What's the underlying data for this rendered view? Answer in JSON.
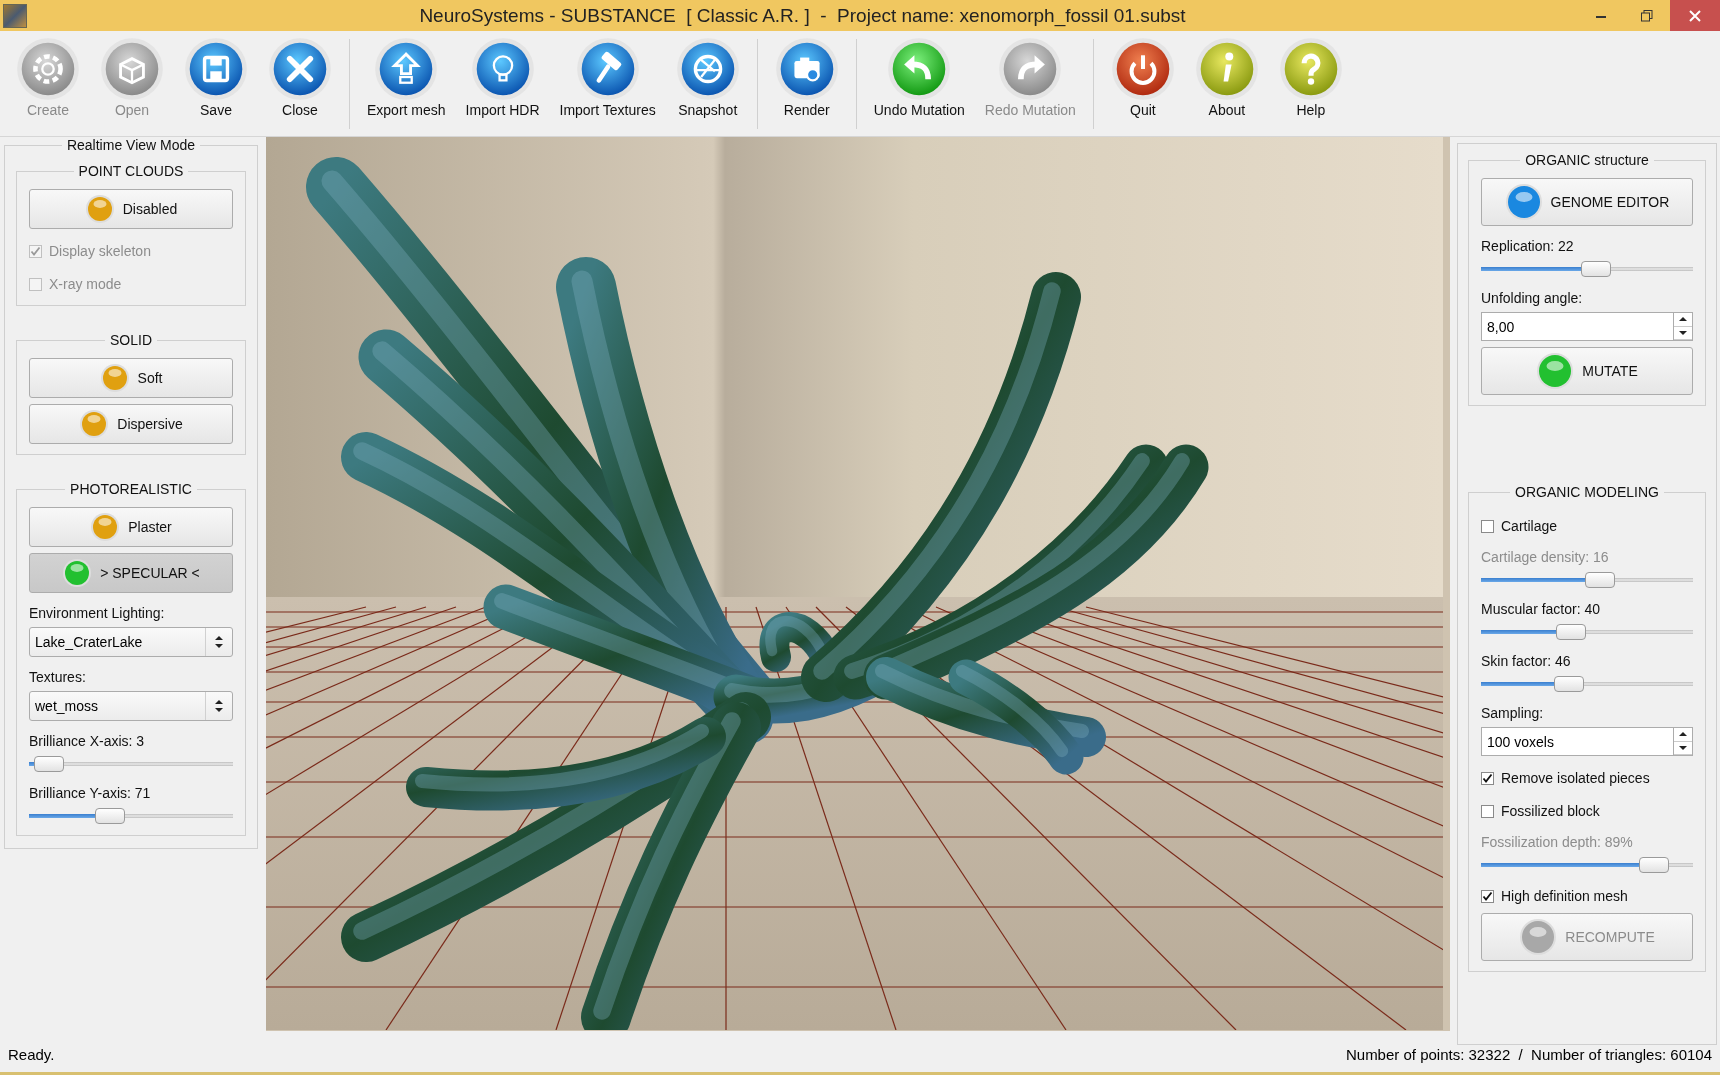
{
  "window": {
    "title": "NeuroSystems - SUBSTANCE  [ Classic A.R. ]  -  Project name: xenomorph_fossil 01.subst"
  },
  "toolbar": {
    "groups": [
      [
        {
          "label": "Create",
          "kind": "gear",
          "disabled": true
        },
        {
          "label": "Open",
          "kind": "box",
          "disabled": true
        },
        {
          "label": "Save",
          "kind": "disk",
          "disabled": false
        },
        {
          "label": "Close",
          "kind": "cross",
          "disabled": false
        }
      ],
      [
        {
          "label": "Export mesh",
          "kind": "upload",
          "disabled": false
        },
        {
          "label": "Import HDR",
          "kind": "bulb",
          "disabled": false
        },
        {
          "label": "Import Textures",
          "kind": "roller",
          "disabled": false
        },
        {
          "label": "Snapshot",
          "kind": "aperture",
          "disabled": false
        }
      ],
      [
        {
          "label": "Render",
          "kind": "camera",
          "disabled": false
        }
      ],
      [
        {
          "label": "Undo Mutation",
          "kind": "undo",
          "disabled": false
        },
        {
          "label": "Redo Mutation",
          "kind": "redo",
          "disabled": true
        }
      ],
      [
        {
          "label": "Quit",
          "kind": "power",
          "disabled": false
        },
        {
          "label": "About",
          "kind": "info",
          "disabled": false
        },
        {
          "label": "Help",
          "kind": "help",
          "disabled": false
        }
      ]
    ]
  },
  "left_panel": {
    "title": "Realtime View Mode",
    "sections": [
      {
        "title": "POINT CLOUDS",
        "items": [
          {
            "kind": "led_button",
            "label": "Disabled",
            "color": "#e0a010",
            "selected": false,
            "disabled": false
          },
          {
            "kind": "checkbox",
            "label": "Display skeleton",
            "checked": true,
            "disabled": true
          },
          {
            "kind": "checkbox",
            "label": "X-ray mode",
            "checked": false,
            "disabled": true
          }
        ]
      },
      {
        "title": "SOLID",
        "items": [
          {
            "kind": "led_button",
            "label": "Soft",
            "color": "#e0a010",
            "selected": false,
            "disabled": false
          },
          {
            "kind": "led_button",
            "label": "Dispersive",
            "color": "#e0a010",
            "selected": false,
            "disabled": false
          }
        ]
      },
      {
        "title": "PHOTOREALISTIC",
        "items": [
          {
            "kind": "led_button",
            "label": "Plaster",
            "color": "#e0a010",
            "selected": false,
            "disabled": false
          },
          {
            "kind": "led_button",
            "label": "> SPECULAR <",
            "color": "#22c030",
            "selected": true,
            "disabled": false
          },
          {
            "kind": "label",
            "label": "Environment Lighting:",
            "disabled": false
          },
          {
            "kind": "combo",
            "value": "Lake_CraterLake"
          },
          {
            "kind": "label",
            "label": "Textures:",
            "disabled": false
          },
          {
            "kind": "combo",
            "value": "wet_moss"
          },
          {
            "kind": "label",
            "label": "Brilliance X-axis: 3",
            "disabled": false
          },
          {
            "kind": "slider",
            "level": 0.03
          },
          {
            "kind": "label",
            "label": "Brilliance Y-axis: 71",
            "disabled": false
          },
          {
            "kind": "slider",
            "level": 0.38
          }
        ]
      }
    ]
  },
  "right_panel": {
    "sections": [
      {
        "title": "ORGANIC structure",
        "items": [
          {
            "kind": "led_button",
            "label": "GENOME EDITOR",
            "color": "#1a88e0",
            "selected": false,
            "disabled": false
          },
          {
            "kind": "label",
            "label": "Replication: 22",
            "disabled": false
          },
          {
            "kind": "slider",
            "level": 0.55
          },
          {
            "kind": "label",
            "label": "Unfolding angle:",
            "disabled": false
          },
          {
            "kind": "spin",
            "value": "8,00"
          },
          {
            "kind": "led_button",
            "label": "MUTATE",
            "color": "#22c030",
            "selected": false,
            "disabled": false
          }
        ]
      },
      {
        "title": "ORGANIC MODELING",
        "items": [
          {
            "kind": "checkbox",
            "label": "Cartilage",
            "checked": false,
            "disabled": false
          },
          {
            "kind": "label",
            "label": "Cartilage density: 16",
            "disabled": true
          },
          {
            "kind": "slider",
            "level": 0.57
          },
          {
            "kind": "label",
            "label": "Muscular factor: 40",
            "disabled": false
          },
          {
            "kind": "slider",
            "level": 0.41
          },
          {
            "kind": "label",
            "label": "Skin factor: 46",
            "disabled": false
          },
          {
            "kind": "slider",
            "level": 0.4
          },
          {
            "kind": "label",
            "label": "Sampling:",
            "disabled": false
          },
          {
            "kind": "spin",
            "value": "100 voxels"
          },
          {
            "kind": "checkbox",
            "label": "Remove isolated pieces",
            "checked": true,
            "disabled": false
          },
          {
            "kind": "checkbox",
            "label": "Fossilized block",
            "checked": false,
            "disabled": false
          },
          {
            "kind": "label",
            "label": "Fossilization depth: 89%",
            "disabled": true
          },
          {
            "kind": "slider",
            "level": 0.87
          },
          {
            "kind": "checkbox",
            "label": "High definition mesh",
            "checked": true,
            "disabled": false
          },
          {
            "kind": "led_button",
            "label": "RECOMPUTE",
            "color": "#a8a8a8",
            "selected": false,
            "disabled": true
          }
        ]
      }
    ]
  },
  "status_bar": {
    "message": "Ready.",
    "stats": "Number of points: 32322  /  Number of triangles: 60104"
  }
}
